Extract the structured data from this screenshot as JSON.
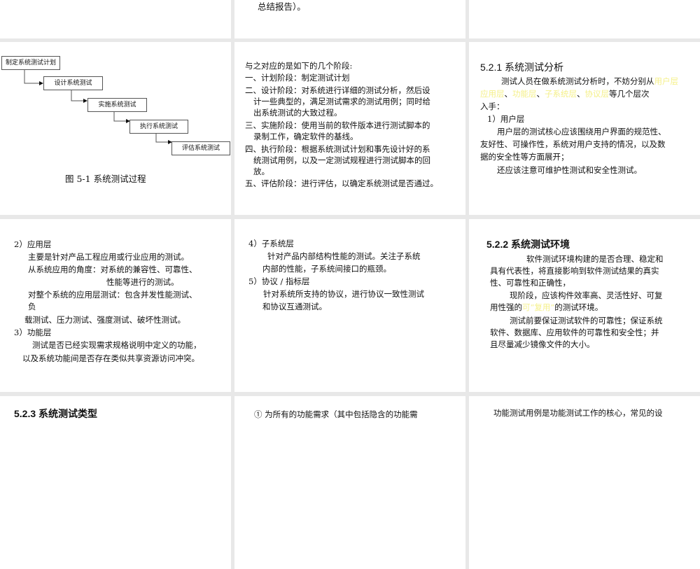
{
  "slides": {
    "r1c2": {
      "last_line": "总结报告）。"
    },
    "r2c1": {
      "flow": [
        "制定系统测试计划",
        "设计系统测试",
        "实施系统测试",
        "执行系统测试",
        "评估系统测试"
      ],
      "caption": "图 5-1 系统测试过程"
    },
    "r2c2": {
      "lines": [
        "与之对应的是如下的几个阶段:",
        "一、计划阶段：制定测试计划",
        "二、设计阶段：对系统进行详细的测试分析，然后设",
        "计一些典型的，满足测试需求的测试用例；同时给",
        "出系统测试的大致过程。",
        "三、实施阶段：使用当前的软件版本进行测试脚本的",
        "录制工作，确定软件的基线。",
        "四、执行阶段：根据系统测试计划和事先设计好的系",
        "统测试用例，以及一定测试规程进行测试脚本的回",
        "放。",
        "五、评估阶段：进行评估，以确定系统测试是否通过。"
      ]
    },
    "r2c3": {
      "title": "5.2.1 系统测试分析",
      "intro_a": "测试人员在做系统测试分析时，不妨分别从",
      "layers": [
        "用户层",
        "应用层",
        "功能层",
        "子系统层",
        "协议层"
      ],
      "sep": "、",
      "intro_b": "等几个层次",
      "intro_c": "入手：",
      "sub": "1）用户层",
      "p1": "用户层的测试核心应该围绕用户界面的规范性、",
      "p2": "友好性、可操作性，系统对用户支持的情况，以及数",
      "p3": "据的安全性等方面展开；",
      "p4": "还应该注意可维护性测试和安全性测试。"
    },
    "r3c1": {
      "lines": [
        "2）应用层",
        "主要是针对产品工程应用或行业应用的测试。",
        "从系统应用的角度：对系统的兼容性、可靠性、",
        "性能等进行的测试。",
        "对整个系统的应用层测试：包含并发性能测试、",
        "负",
        "载测试、压力测试、强度测试、破坏性测试。",
        "3）功能层",
        "测试是否已经实现需求规格说明中定义的功能，",
        "以及系统功能间是否存在类似共享资源访问冲突。"
      ]
    },
    "r3c2": {
      "lines": [
        "4）子系统层",
        "针对产品内部结构性能的测试。关注子系统",
        "内部的性能，子系统间接口的瓶颈。",
        "5）协议 / 指标层",
        "针对系统所支持的协议，进行协议一致性测试",
        "和协议互通测试。"
      ]
    },
    "r3c3": {
      "title": "5.2.2 系统测试环境",
      "l1": "软件测试环境构建的是否合理、稳定和",
      "l2": "具有代表性，将直接影响到软件测试结果的真实",
      "l3": "性、可靠性和正确性，",
      "l4": "现阶段，应该构件效率高、灵活性好、可复",
      "l5a": "用性强的",
      "l5hl": "可“复用”",
      "l5b": "的测试环境。",
      "l6": "测试前要保证测试软件的可靠性；保证系统",
      "l7": "软件、数据库、应用软件的可靠性和安全性；并",
      "l8": "且尽量减少镜像文件的大小。"
    },
    "r4c1": {
      "title": "5.2.3 系统测试类型"
    },
    "r4c2": {
      "line": "①  为所有的功能需求（其中包括隐含的功能需"
    },
    "r4c3": {
      "line": "功能测试用例是功能测试工作的核心，常见的设"
    }
  }
}
